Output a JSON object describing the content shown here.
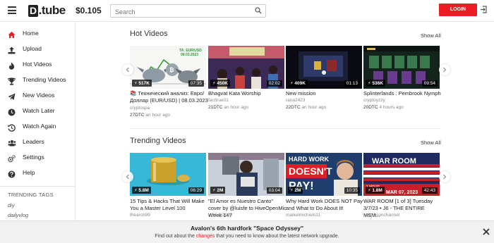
{
  "header": {
    "logo_text": "tube",
    "logo_letter": "D",
    "logo_dot": ".",
    "balance": "$0.105",
    "search_placeholder": "Search",
    "login_label": "LOGIN"
  },
  "sidebar": {
    "items": [
      {
        "label": "Home",
        "icon": "home-icon"
      },
      {
        "label": "Upload",
        "icon": "upload-icon"
      },
      {
        "label": "Hot Videos",
        "icon": "flame-icon"
      },
      {
        "label": "Trending Videos",
        "icon": "trophy-icon"
      },
      {
        "label": "New Videos",
        "icon": "paper-plane-icon"
      },
      {
        "label": "Watch Later",
        "icon": "clock-icon"
      },
      {
        "label": "Watch Again",
        "icon": "history-icon"
      },
      {
        "label": "Leaders",
        "icon": "users-icon"
      },
      {
        "label": "Settings",
        "icon": "gears-icon"
      },
      {
        "label": "Help",
        "icon": "question-icon"
      }
    ],
    "trending_title": "TRENDING TAGS",
    "tags": [
      "diy",
      "dailyvlog"
    ]
  },
  "hot": {
    "title": "Hot Videos",
    "show_all": "Show All",
    "videos": [
      {
        "title": "📚 Технический анализ: Евро/Доллар (EUR/USD) | 08.03.2023",
        "author": "cryptospa",
        "dtc": "27DTC",
        "ago": "an hour ago",
        "views": "517K",
        "duration": "07:35",
        "thumb_text": "TA: EUR/USD\n08.03.2023"
      },
      {
        "title": "Bhagvat Kata Worship",
        "author": "facttrue01",
        "dtc": "21DTC",
        "ago": "an hour ago",
        "views": "450K",
        "duration": "02:02"
      },
      {
        "title": "New mission",
        "author": "rana2423",
        "dtc": "22DTC",
        "ago": "an hour ago",
        "views": "409K",
        "duration": "01:13"
      },
      {
        "title": "Splinterlands : Pembrook Nymph",
        "author": "cryptoyzzy",
        "dtc": "20DTC",
        "ago": "4 hours ago",
        "views": "536K",
        "duration": "09:54"
      }
    ]
  },
  "trending": {
    "title": "Trending Videos",
    "show_all": "Show All",
    "videos": [
      {
        "title": "15 Tips & Hacks That Will Make You a Master Level 100",
        "author": "thearch99",
        "views": "5.8M",
        "duration": "06:29"
      },
      {
        "title": "\"El Amor es Nuestro Canto\" cover by @luisfe to HiveOpenMic Week 147",
        "author": "luisfwp2002",
        "views": "2M",
        "duration": "03:04"
      },
      {
        "title": "Why Hard Work DOES NOT Pay and What to Do About It!",
        "author": "maikelmichiels11",
        "views": "2M",
        "duration": "10:35",
        "thumb_line1": "HARD WORK",
        "thumb_line2": "DOESN'T",
        "thumb_line3": "PAY!"
      },
      {
        "title": "WAR ROOM [1 of 3] Tuesday 3/7/23 • J6 - THE ENTIRE MSM...",
        "author": "rongibsonchannel",
        "views": "1.8M",
        "duration": "42:43",
        "thumb_line1": "WAR ROOM",
        "thumb_line2": "1 HOUR",
        "thumb_line3": "MAR 07, 2023"
      }
    ]
  },
  "announcement": {
    "title": "Avalon's 6th hardfork \"Space Odyssey\"",
    "text_before": "Find out about the ",
    "link": "changes",
    "text_after": " that you need to know about the latest network upgrade."
  },
  "colors": {
    "accent": "#ee1c25"
  }
}
